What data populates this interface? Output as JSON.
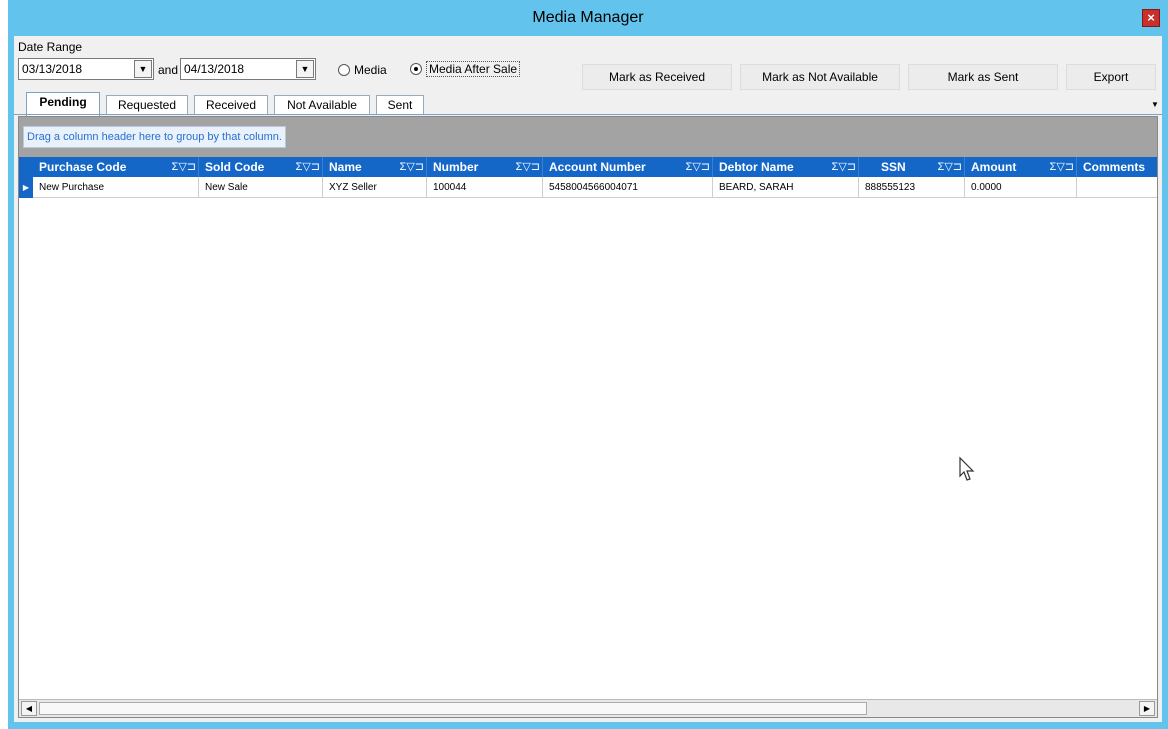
{
  "window": {
    "title": "Media Manager",
    "close_glyph": "×"
  },
  "filters": {
    "date_range_label": "Date Range",
    "start_date": "03/13/2018",
    "and_label": "and",
    "end_date": "04/13/2018",
    "radio_media": "Media",
    "radio_media_after_sale": "Media After Sale",
    "selected_radio": "Media After Sale"
  },
  "toolbar": {
    "mark_received": "Mark as Received",
    "mark_not_available": "Mark as Not Available",
    "mark_sent": "Mark as Sent",
    "export": "Export"
  },
  "tabs": [
    {
      "label": "Pending",
      "active": true
    },
    {
      "label": "Requested",
      "active": false
    },
    {
      "label": "Received",
      "active": false
    },
    {
      "label": "Not Available",
      "active": false
    },
    {
      "label": "Sent",
      "active": false
    }
  ],
  "grid": {
    "group_hint": "Drag a column header here to group by that column.",
    "header_icons": "Σ▽⊐",
    "columns": [
      "Purchase Code",
      "Sold Code",
      "Name",
      "Number",
      "Account Number",
      "Debtor Name",
      "SSN",
      "Amount",
      "Comments"
    ],
    "rows": [
      {
        "purchase_code": "New Purchase",
        "sold_code": "New Sale",
        "name": "XYZ Seller",
        "number": "100044",
        "account_number": "5458004566004071",
        "debtor_name": "BEARD, SARAH",
        "ssn": "888555123",
        "amount": "0.0000",
        "comments": ""
      }
    ]
  },
  "icons": {
    "close": "close-icon",
    "dropdown": "chevron-down-icon",
    "row_indicator": "row-pointer-icon",
    "scroll_left": "scroll-left-icon",
    "scroll_right": "scroll-right-icon",
    "tab_overflow": "tab-overflow-icon",
    "cursor": "mouse-cursor-icon"
  },
  "colors": {
    "titlebar": "#62c4ec",
    "grid_header": "#1467c7",
    "group_panel": "#a3a3a3",
    "close_button": "#c9302c"
  }
}
